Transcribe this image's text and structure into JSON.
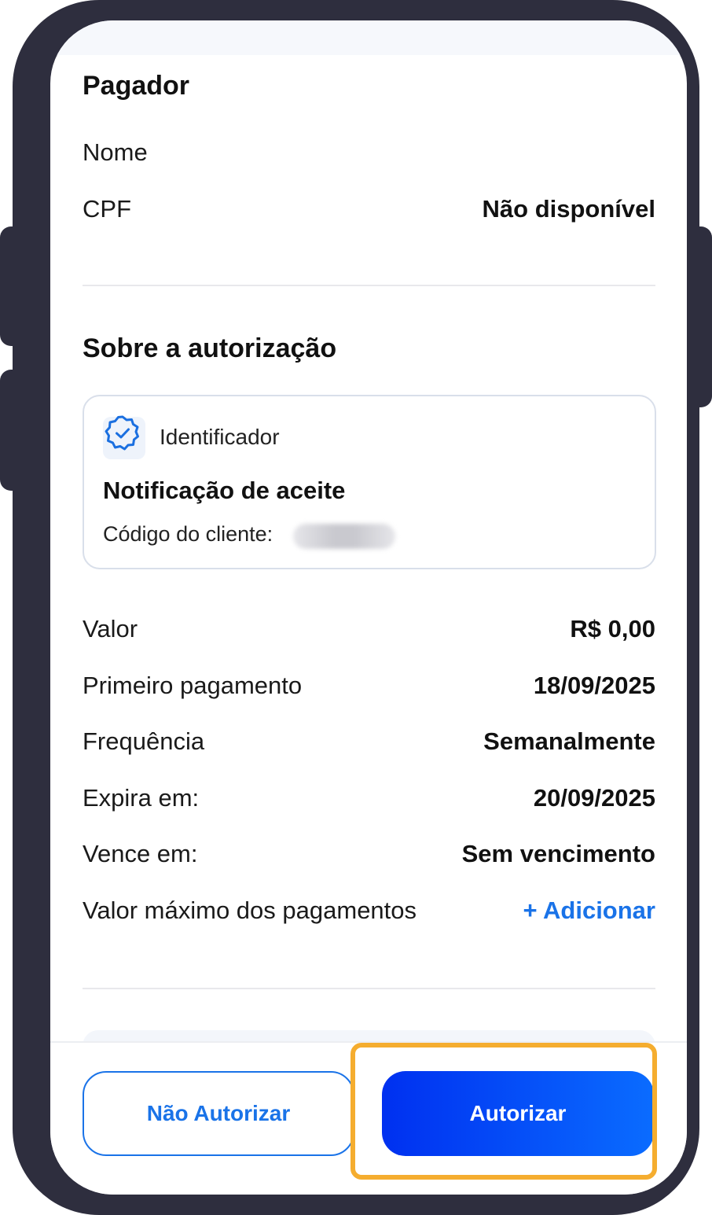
{
  "payer": {
    "title": "Pagador",
    "name_label": "Nome",
    "name_value": "",
    "cpf_label": "CPF",
    "cpf_value": "Não disponível"
  },
  "authorization": {
    "title": "Sobre a autorização",
    "card": {
      "tag": "Identificador",
      "title": "Notificação de aceite",
      "code_label": "Código do cliente:"
    },
    "rows": [
      {
        "label": "Valor",
        "value": "R$ 0,00"
      },
      {
        "label": "Primeiro pagamento",
        "value": "18/09/2025"
      },
      {
        "label": "Frequência",
        "value": "Semanalmente"
      },
      {
        "label": "Expira em:",
        "value": "20/09/2025"
      },
      {
        "label": "Vence em:",
        "value": "Sem vencimento"
      },
      {
        "label": "Valor máximo dos pagamentos",
        "value": "+ Adicionar"
      }
    ]
  },
  "actions": {
    "decline_label": "Não Autorizar",
    "approve_label": "Autorizar"
  },
  "colors": {
    "accent": "#1a73e8",
    "primary_button": "#0030f0",
    "highlight": "#f5ad2f",
    "device_frame": "#2e2e3e"
  },
  "icons": {
    "identifier": "verified-badge-icon"
  }
}
